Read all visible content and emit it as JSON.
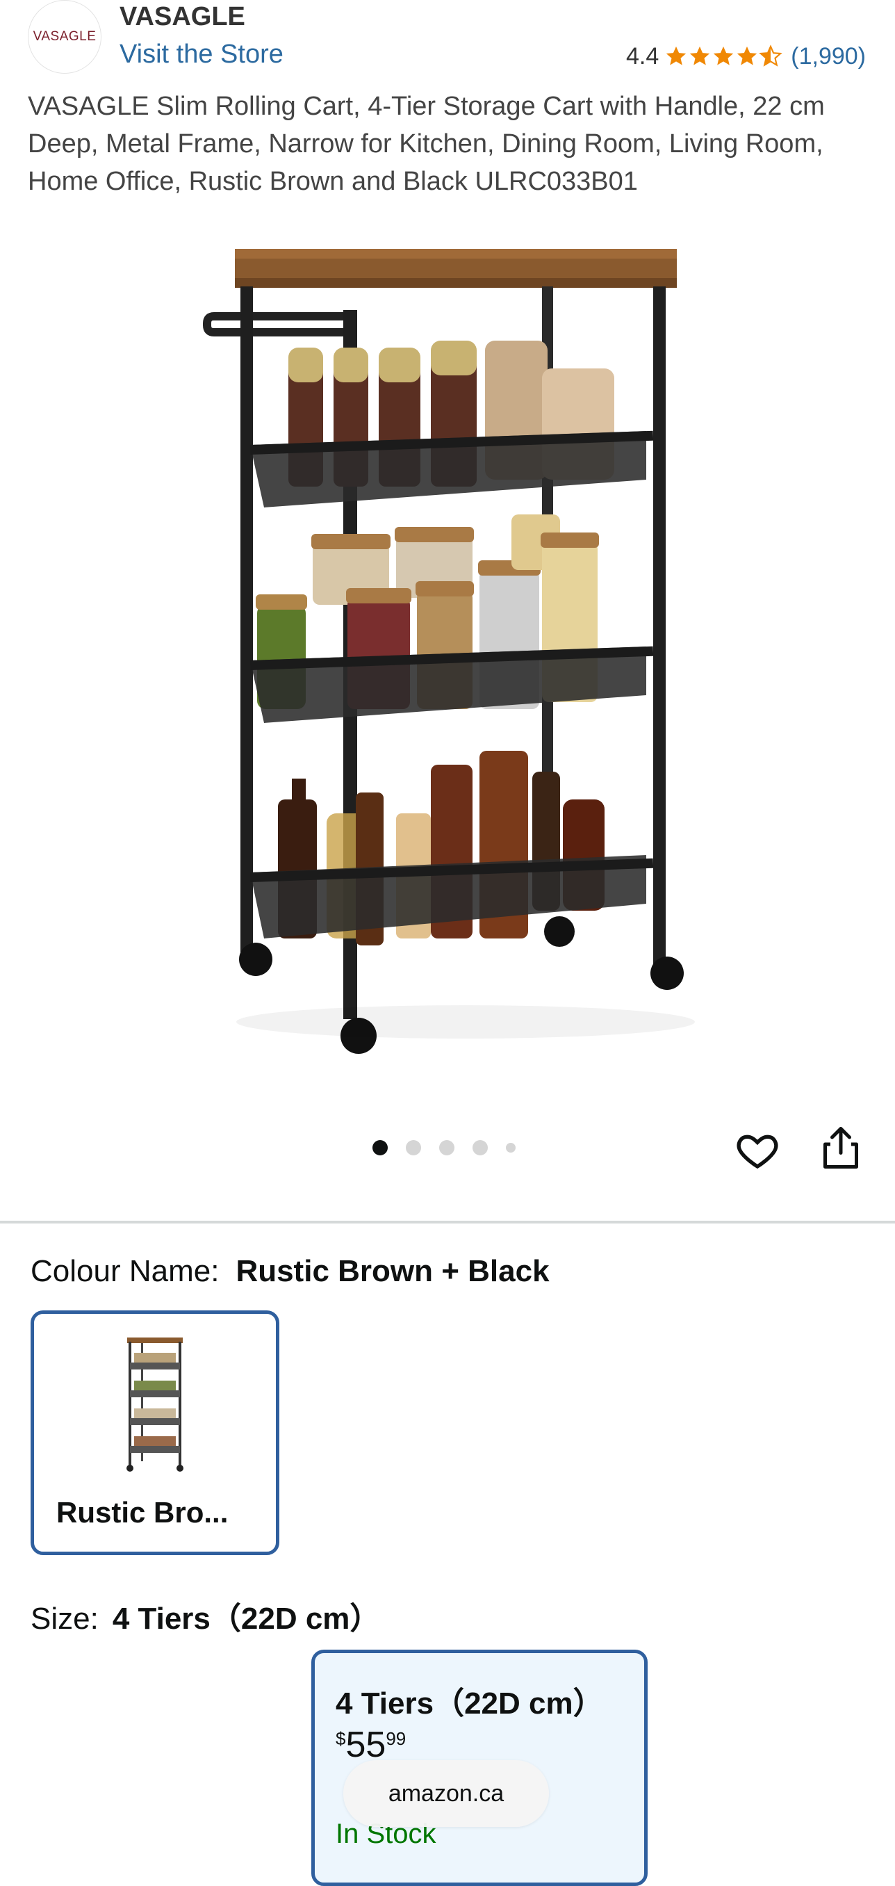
{
  "header": {
    "logo_text": "VASAGLE",
    "brand": "VASAGLE",
    "visit_store": "Visit the Store",
    "rating": "4.4",
    "rating_stars": 4.4,
    "rating_count": "(1,990)",
    "star_color": "#f08804"
  },
  "product": {
    "title": "VASAGLE Slim Rolling Cart, 4-Tier Storage Cart with Handle, 22 cm Deep, Metal Frame, Narrow for Kitchen, Dining Room, Living Room, Home Office, Rustic Brown and Black ULRC033B01",
    "image_count": 5,
    "active_image": 1
  },
  "actions": {
    "wishlist_icon": "heart-icon",
    "share_icon": "share-icon"
  },
  "variations": {
    "colour_label": "Colour Name:",
    "colour_value": "Rustic Brown + Black",
    "colour_option": "Rustic Bro...",
    "size_label": "Size:",
    "size_value": "4 Tiers（22D cm）",
    "size_option": {
      "label": "4 Tiers（22D cm）",
      "price_currency": "$",
      "price_whole": "55",
      "price_fraction": "99",
      "availability": "In Stock"
    }
  },
  "browser": {
    "domain": "amazon.ca"
  },
  "colors": {
    "link": "#2c6aa0",
    "selected_border": "#2f5f9e",
    "in_stock": "#007600"
  }
}
